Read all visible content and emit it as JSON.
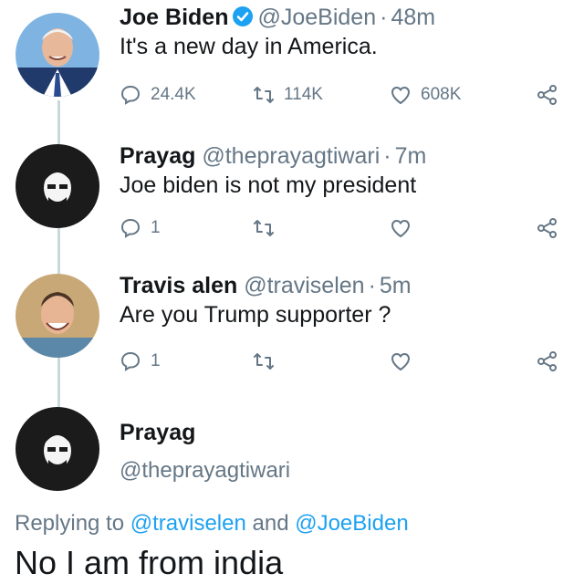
{
  "tweets": [
    {
      "name": "Joe Biden",
      "handle": "@JoeBiden",
      "dot": "·",
      "time": "48m",
      "text": "It's a new day in America.",
      "replies": "24.4K",
      "retweets": "114K",
      "likes": "608K",
      "verified": true
    },
    {
      "name": "Prayag",
      "handle": "@theprayagtiwari",
      "dot": "·",
      "time": "7m",
      "text": "Joe biden is not my president",
      "replies": "1",
      "retweets": "",
      "likes": ""
    },
    {
      "name": "Travis alen",
      "handle": "@traviselen",
      "dot": "·",
      "time": "5m",
      "text": "Are you Trump supporter ?",
      "replies": "1",
      "retweets": "",
      "likes": ""
    }
  ],
  "reply": {
    "name": "Prayag",
    "handle": "@theprayagtiwari",
    "replying_prefix": "Replying to",
    "mention1": "@traviselen",
    "and": "and",
    "mention2": "@JoeBiden",
    "text": "No I am from india"
  },
  "icons": {
    "reply": "reply-icon",
    "retweet": "retweet-icon",
    "like": "heart-icon",
    "share": "share-icon",
    "verified": "verified-badge-icon"
  },
  "colors": {
    "accent": "#1da1f2",
    "muted": "#657786",
    "text": "#14171a",
    "thread_line": "#ccd6dd"
  }
}
